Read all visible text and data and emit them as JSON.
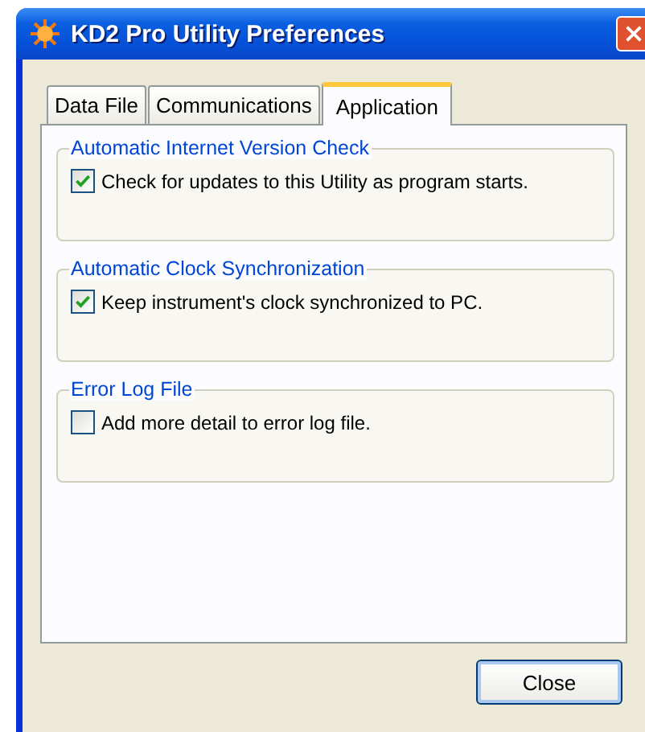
{
  "window": {
    "title": "KD2 Pro Utility Preferences"
  },
  "tabs": [
    {
      "label": "Data File",
      "selected": false
    },
    {
      "label": "Communications",
      "selected": false
    },
    {
      "label": "Application",
      "selected": true
    }
  ],
  "groups": [
    {
      "title": "Automatic Internet Version Check",
      "option": {
        "label": "Check for updates to this Utility as program starts.",
        "checked": true
      }
    },
    {
      "title": "Automatic Clock Synchronization",
      "option": {
        "label": "Keep instrument's clock synchronized to PC.",
        "checked": true
      }
    },
    {
      "title": "Error Log File",
      "option": {
        "label": "Add more detail to error log file.",
        "checked": false
      }
    }
  ],
  "buttons": [
    "Close"
  ]
}
